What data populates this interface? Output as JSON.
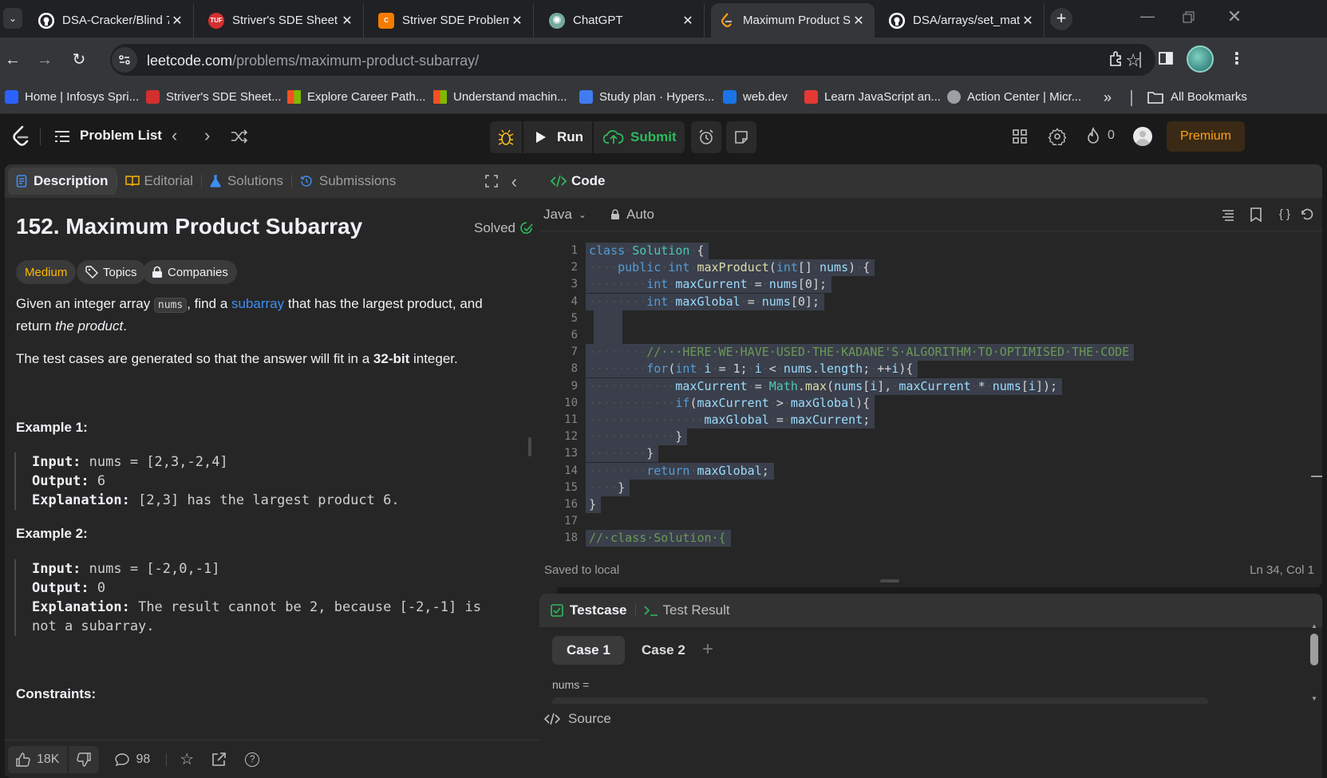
{
  "browser": {
    "tabs": [
      {
        "label": "DSA-Cracker/Blind 7",
        "icon": "github-icon",
        "color": "#ffffff"
      },
      {
        "label": "Striver's SDE Sheet –",
        "icon": "tuf-icon",
        "color": "#d32f2f"
      },
      {
        "label": "Striver SDE Problems",
        "icon": "codestudio-icon",
        "color": "#f57c00"
      },
      {
        "label": "ChatGPT",
        "icon": "chatgpt-icon",
        "color": "#74aa9c"
      },
      {
        "label": "Maximum Product Su",
        "icon": "leetcode-icon",
        "color": "#ffa116"
      },
      {
        "label": "DSA/arrays/set_matr",
        "icon": "github-icon",
        "color": "#ffffff"
      }
    ],
    "url_host": "leetcode.com",
    "url_path": "/problems/maximum-product-subarray/",
    "bookmarks": [
      {
        "label": "Home | Infosys Spri...",
        "color": "#2962ff"
      },
      {
        "label": "Striver's SDE Sheet...",
        "color": "#d32f2f"
      },
      {
        "label": "Explore Career Path...",
        "color": "#f25022"
      },
      {
        "label": "Understand machin...",
        "color": "#7fba00"
      },
      {
        "label": "Study plan · Hypers...",
        "color": "#3f7cf0"
      },
      {
        "label": "web.dev",
        "color": "#1a73e8"
      },
      {
        "label": "Learn JavaScript an...",
        "color": "#e53935"
      },
      {
        "label": "Action Center | Micr...",
        "color": "#9aa0a6"
      }
    ],
    "all_bookmarks": "All Bookmarks",
    "more": "»"
  },
  "header": {
    "problem_list": "Problem List",
    "run": "Run",
    "submit": "Submit",
    "streak": "0",
    "premium": "Premium"
  },
  "left": {
    "tabs": [
      "Description",
      "Editorial",
      "Solutions",
      "Submissions"
    ],
    "title": "152. Maximum Product Subarray",
    "solved": "Solved",
    "difficulty": "Medium",
    "topics": "Topics",
    "companies": "Companies",
    "desc1_a": "Given an integer array ",
    "desc1_code": "nums",
    "desc1_b": ", find a ",
    "desc1_link": "subarray",
    "desc1_c": " that has the largest product, and return ",
    "desc1_em": "the product",
    "desc1_d": ".",
    "desc2_a": "The test cases are generated so that the answer will fit in a ",
    "desc2_b": "32-bit",
    "desc2_c": " integer.",
    "ex1_title": "Example 1:",
    "ex1_input": "nums = [2,3,-2,4]",
    "ex1_output": "6",
    "ex1_expl": "[2,3] has the largest product 6.",
    "ex2_title": "Example 2:",
    "ex2_input": "nums = [-2,0,-1]",
    "ex2_output": "0",
    "ex2_expl": "The result cannot be 2, because [-2,-1] is not a subarray.",
    "label_input": "Input:",
    "label_output": "Output:",
    "label_expl": "Explanation:",
    "constraints": "Constraints:",
    "likes": "18K",
    "comments": "98"
  },
  "code": {
    "panel_title": "Code",
    "language": "Java",
    "mode": "Auto",
    "status_left": "Saved to local",
    "status_right": "Ln 34, Col 1",
    "lines": [
      "class Solution {",
      "    public int maxProduct(int[] nums) {",
      "        int maxCurrent = nums[0];",
      "        int maxGlobal = nums[0];",
      "",
      "",
      "        //   HERE WE HAVE USED THE KADANE'S ALGORITHM TO OPTIMISED THE CODE",
      "        for(int i = 1; i < nums.length; ++i){",
      "            maxCurrent = Math.max(nums[i], maxCurrent * nums[i]);",
      "            if(maxCurrent > maxGlobal){",
      "                maxGlobal = maxCurrent;",
      "            }",
      "        }",
      "        return maxGlobal;",
      "    }",
      "}",
      "",
      "// class Solution {"
    ]
  },
  "bottom": {
    "testcase": "Testcase",
    "test_result": "Test Result",
    "case1": "Case 1",
    "case2": "Case 2",
    "nums_label": "nums =",
    "source": "Source"
  }
}
